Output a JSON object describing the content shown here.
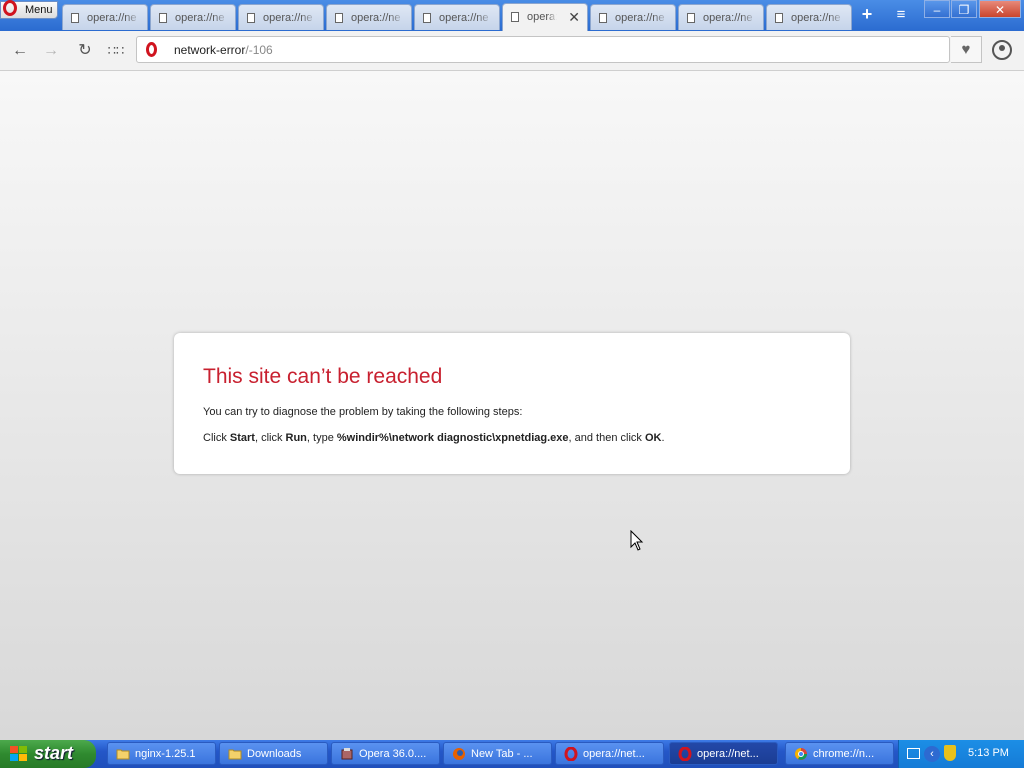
{
  "browser": {
    "menu_label": "Menu",
    "tabs": [
      {
        "title": "opera://ne",
        "active": false
      },
      {
        "title": "opera://ne",
        "active": false
      },
      {
        "title": "opera://ne",
        "active": false
      },
      {
        "title": "opera://ne",
        "active": false
      },
      {
        "title": "opera://ne",
        "active": false
      },
      {
        "title": "opera:/",
        "active": true
      },
      {
        "title": "opera://ne",
        "active": false
      },
      {
        "title": "opera://ne",
        "active": false
      },
      {
        "title": "opera://ne",
        "active": false
      }
    ],
    "new_tab_symbol": "+",
    "tab_menu_symbol": "≡",
    "close_tab_symbol": "✕",
    "window_buttons": {
      "minimize": "–",
      "restore": "❐",
      "close": "✕"
    }
  },
  "address_bar": {
    "url_main": "network-error",
    "url_suffix": "/-106",
    "heart_symbol": "♥"
  },
  "error_page": {
    "title": "This site can’t be reached",
    "description": "You can try to diagnose the problem by taking the following steps:",
    "steps": {
      "p1": "Click ",
      "start": "Start",
      "p2": ", click ",
      "run": "Run",
      "p3": ", type ",
      "path": "%windir%\\network diagnostic\\xpnetdiag.exe",
      "p4": ", and then click ",
      "ok": "OK",
      "p5": "."
    }
  },
  "taskbar": {
    "start_label": "start",
    "items": [
      {
        "label": "nginx-1.25.1",
        "icon": "folder-icon",
        "active": false
      },
      {
        "label": "Downloads",
        "icon": "folder-icon",
        "active": false
      },
      {
        "label": "Opera 36.0....",
        "icon": "installer-icon",
        "active": false
      },
      {
        "label": "New Tab - ...",
        "icon": "firefox-icon",
        "active": false
      },
      {
        "label": "opera://net...",
        "icon": "opera-icon",
        "active": false
      },
      {
        "label": "opera://net...",
        "icon": "opera-icon",
        "active": true
      },
      {
        "label": "chrome://n...",
        "icon": "chrome-icon",
        "active": false
      }
    ],
    "clock": "5:13 PM"
  },
  "colors": {
    "error_title": "#c8202f",
    "opera_red": "#d0141f",
    "taskbar_blue": "#2457c8",
    "start_green": "#2f8a2f"
  }
}
